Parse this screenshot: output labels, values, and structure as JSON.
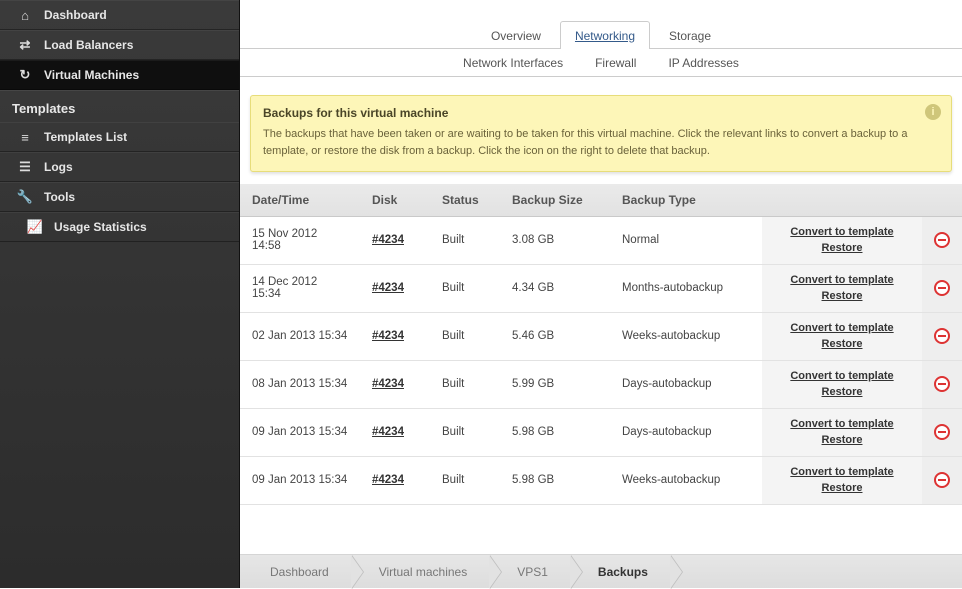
{
  "sidebar": {
    "items": [
      {
        "label": "Dashboard",
        "icon": "home"
      },
      {
        "label": "Load Balancers",
        "icon": "balancer"
      },
      {
        "label": "Virtual Machines",
        "icon": "refresh",
        "active": true
      }
    ],
    "heading": "Templates",
    "sub": [
      {
        "label": "Templates List",
        "icon": "list"
      },
      {
        "label": "Logs",
        "icon": "logs"
      },
      {
        "label": "Tools",
        "icon": "wrench"
      },
      {
        "label": "Usage Statistics",
        "icon": "stats",
        "indent": true
      }
    ]
  },
  "tabs": {
    "primary": [
      {
        "label": "Overview"
      },
      {
        "label": "Networking",
        "active": true,
        "link": true
      },
      {
        "label": "Storage"
      }
    ],
    "secondary": [
      {
        "label": "Network Interfaces"
      },
      {
        "label": "Firewall"
      },
      {
        "label": "IP Addresses"
      }
    ]
  },
  "notice": {
    "title": "Backups for this virtual machine",
    "body": "The backups that have been taken or are waiting to be taken for this virtual machine. Click the relevant links to convert a backup to a template, or restore the disk from a backup. Click the icon on the right to delete that backup."
  },
  "table": {
    "headers": [
      "Date/Time",
      "Disk",
      "Status",
      "Backup Size",
      "Backup Type",
      "",
      ""
    ],
    "action_labels": {
      "convert": "Convert to template",
      "restore": "Restore"
    },
    "rows": [
      {
        "datetime": "15 Nov 2012 14:58",
        "disk": "#4234",
        "status": "Built",
        "size": "3.08 GB",
        "type": "Normal"
      },
      {
        "datetime": "14 Dec 2012 15:34",
        "disk": "#4234",
        "status": "Built",
        "size": "4.34 GB",
        "type": "Months-autobackup"
      },
      {
        "datetime": "02 Jan 2013 15:34",
        "disk": "#4234",
        "status": "Built",
        "size": "5.46 GB",
        "type": "Weeks-autobackup"
      },
      {
        "datetime": "08 Jan 2013 15:34",
        "disk": "#4234",
        "status": "Built",
        "size": "5.99 GB",
        "type": "Days-autobackup"
      },
      {
        "datetime": "09 Jan 2013 15:34",
        "disk": "#4234",
        "status": "Built",
        "size": "5.98 GB",
        "type": "Days-autobackup"
      },
      {
        "datetime": "09 Jan 2013 15:34",
        "disk": "#4234",
        "status": "Built",
        "size": "5.98 GB",
        "type": "Weeks-autobackup"
      }
    ]
  },
  "breadcrumbs": [
    {
      "label": "Dashboard"
    },
    {
      "label": "Virtual machines"
    },
    {
      "label": "VPS1"
    },
    {
      "label": "Backups",
      "active": true
    }
  ]
}
